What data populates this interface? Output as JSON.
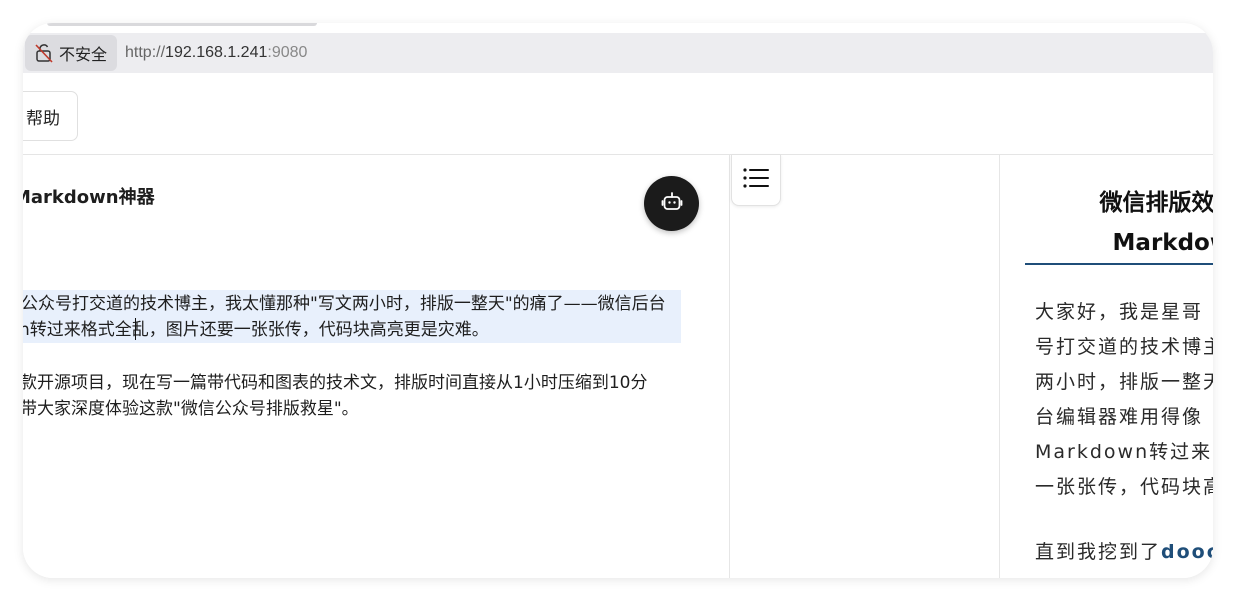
{
  "browser": {
    "security_label": "不安全",
    "url_scheme": "http://",
    "url_host": "192.168.1.241",
    "url_port": ":9080"
  },
  "toolbar": {
    "help_label": "帮助"
  },
  "editor": {
    "title": "Markdown神器",
    "lines": [
      "公众号打交道的技术博主，我太懂那种\"写文两小时，排版一整天\"的痛了——微信后台",
      "n转过来格式全乱，图片还要一张张传，代码块高亮更是灾难。",
      "款开源项目，现在写一篇带代码和图表的技术文，排版时间直接从1小时压缩到10分",
      "带大家深度体验这款\"微信公众号排版救星\"。"
    ]
  },
  "preview": {
    "h1_line1": "微信排版效率炸",
    "h1_line2": "Markdown",
    "lines": [
      "大家好，我是星哥",
      "号打交道的技术博主",
      "两小时，排版一整天",
      "台编辑器难用得像",
      "Markdown转过来",
      "一张张传，代码块高"
    ],
    "last_line_prefix": "直到我挖到了",
    "last_line_highlight": "doocs"
  },
  "colors": {
    "selection": "#e8f0fc",
    "heading_rule": "#1f4e79",
    "ai_button": "#1b1b1b"
  },
  "icons": {
    "security": "unlocked-icon",
    "ai": "robot-icon",
    "toc": "list-icon"
  }
}
